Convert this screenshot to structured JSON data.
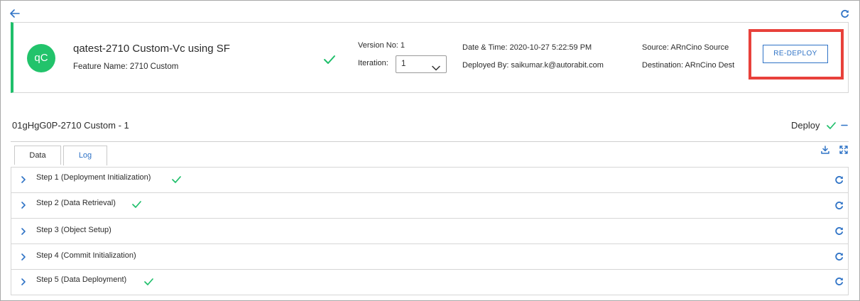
{
  "header": {
    "back_icon": "arrow-left-icon",
    "refresh_icon": "refresh-icon"
  },
  "card": {
    "avatar": "qC",
    "name": "qatest-2710 Custom-Vc using SF",
    "feature": "Feature Name: 2710 Custom",
    "status_icon": "check-icon",
    "version_label": "Version No: 1",
    "iteration_label": "Iteration:",
    "iteration_value": "1",
    "datetime": "Date & Time: 2020-10-27 5:22:59 PM",
    "deployed_by": "Deployed By: saikumar.k@autorabit.com",
    "source": "Source: ARnCino Source",
    "destination": "Destination: ARnCino Dest",
    "redeploy_label": "RE-DEPLOY"
  },
  "section": {
    "title": "01gHgG0P-2710 Custom - 1",
    "deploy_label": "Deploy"
  },
  "tabs": [
    {
      "label": "Data"
    },
    {
      "label": "Log"
    }
  ],
  "steps": [
    {
      "label": "Step 1 (Deployment Initialization)",
      "done": true
    },
    {
      "label": "Step 2 (Data Retrieval)",
      "done": true
    },
    {
      "label": "Step 3 (Object Setup)",
      "done": false
    },
    {
      "label": "Step 4 (Commit Initialization)",
      "done": false
    },
    {
      "label": "Step 5 (Data Deployment)",
      "done": true
    }
  ],
  "colors": {
    "accent": "#2f73c6",
    "success": "#1fbf6b",
    "highlight": "#e8413b"
  }
}
